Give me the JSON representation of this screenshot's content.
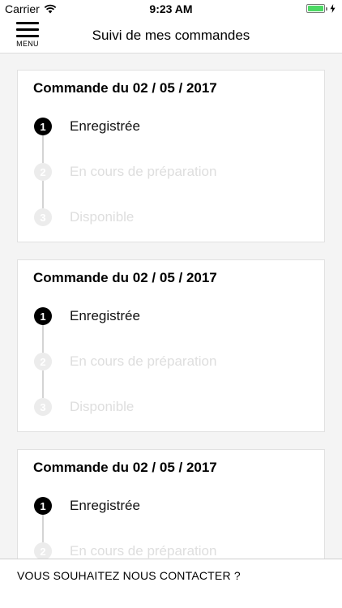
{
  "status_bar": {
    "carrier": "Carrier",
    "time": "9:23 AM",
    "battery_color": "#4cd964"
  },
  "header": {
    "menu_label": "MENU",
    "title": "Suivi de mes commandes"
  },
  "orders": [
    {
      "title": "Commande du 02 / 05 / 2017",
      "steps": [
        {
          "number": "1",
          "label": "Enregistrée",
          "active": true
        },
        {
          "number": "2",
          "label": "En cours de préparation",
          "active": false
        },
        {
          "number": "3",
          "label": "Disponible",
          "active": false
        }
      ]
    },
    {
      "title": "Commande du 02 / 05 / 2017",
      "steps": [
        {
          "number": "1",
          "label": "Enregistrée",
          "active": true
        },
        {
          "number": "2",
          "label": "En cours de préparation",
          "active": false
        },
        {
          "number": "3",
          "label": "Disponible",
          "active": false
        }
      ]
    },
    {
      "title": "Commande du 02 / 05 / 2017",
      "steps": [
        {
          "number": "1",
          "label": "Enregistrée",
          "active": true
        },
        {
          "number": "2",
          "label": "En cours de préparation",
          "active": false
        }
      ]
    }
  ],
  "footer": {
    "contact_label": "VOUS SOUHAITEZ NOUS CONTACTER ?"
  },
  "colors": {
    "step_active": "#000000",
    "step_inactive": "#ececec",
    "text_inactive": "#dedede"
  }
}
